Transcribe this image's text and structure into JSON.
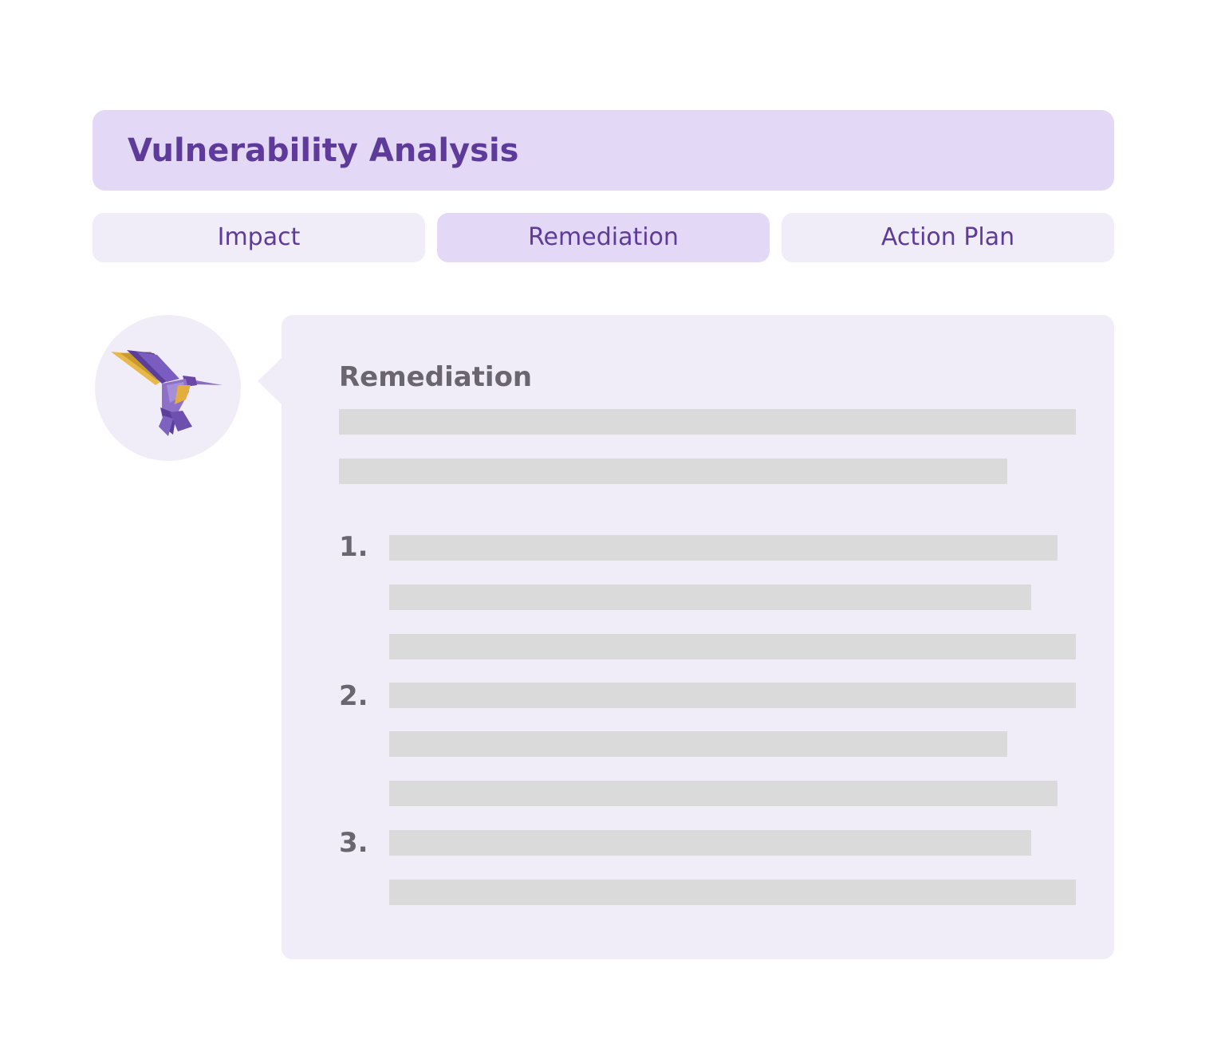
{
  "header": {
    "title": "Vulnerability Analysis"
  },
  "tabs": [
    {
      "label": "Impact",
      "active": false
    },
    {
      "label": "Remediation",
      "active": true
    },
    {
      "label": "Action Plan",
      "active": false
    }
  ],
  "assistant": {
    "avatar_icon": "hummingbird-icon"
  },
  "response": {
    "heading": "Remediation",
    "list_markers": [
      "1.",
      "2.",
      "3."
    ]
  },
  "colors": {
    "accent": "#5e3a9a",
    "header_bg": "#e3d8f6",
    "panel_bg": "#f0ecf8",
    "placeholder": "#dadada",
    "heading_text": "#6b6570"
  }
}
